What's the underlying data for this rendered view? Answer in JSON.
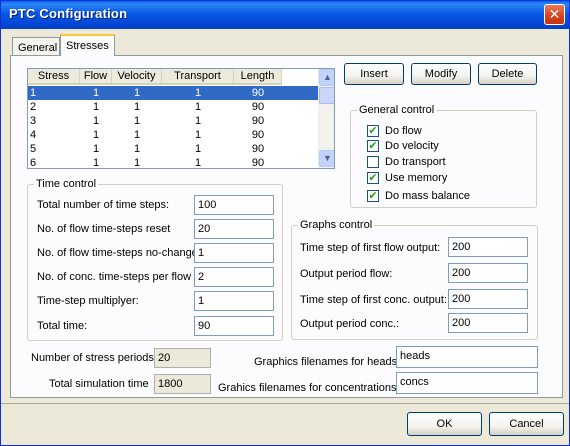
{
  "window": {
    "title": "PTC Configuration",
    "close_glyph": "✕"
  },
  "tabs": [
    {
      "label": "General"
    },
    {
      "label": "Stresses"
    }
  ],
  "stress_table": {
    "columns": [
      "Stress",
      "Flow",
      "Velocity",
      "Transport",
      "Length"
    ],
    "rows": [
      [
        "1",
        "1",
        "1",
        "1",
        "90"
      ],
      [
        "2",
        "1",
        "1",
        "1",
        "90"
      ],
      [
        "3",
        "1",
        "1",
        "1",
        "90"
      ],
      [
        "4",
        "1",
        "1",
        "1",
        "90"
      ],
      [
        "5",
        "1",
        "1",
        "1",
        "90"
      ],
      [
        "6",
        "1",
        "1",
        "1",
        "90"
      ]
    ],
    "selected_row": 0,
    "scroll_up_icon": "chevron-up-icon",
    "scroll_down_icon": "chevron-down-icon"
  },
  "actions": {
    "insert": "Insert",
    "modify": "Modify",
    "delete": "Delete"
  },
  "general_control": {
    "title": "General control",
    "items": [
      {
        "label": "Do flow",
        "checked": true
      },
      {
        "label": "Do velocity",
        "checked": true
      },
      {
        "label": "Do transport",
        "checked": false
      },
      {
        "label": "Use memory",
        "checked": true
      },
      {
        "label": "Do mass balance",
        "checked": true
      }
    ]
  },
  "time_control": {
    "title": "Time control",
    "fields": [
      {
        "label": "Total number of time steps:",
        "value": "100"
      },
      {
        "label": "No. of flow time-steps reset",
        "value": "20"
      },
      {
        "label": "No. of flow time-steps no-change",
        "value": "1"
      },
      {
        "label": "No. of conc. time-steps per flow",
        "value": "2"
      },
      {
        "label": "Time-step multiplyer:",
        "value": "1"
      },
      {
        "label": "Total time:",
        "value": "90"
      }
    ]
  },
  "graphs_control": {
    "title": "Graphs control",
    "fields": [
      {
        "label": "Time step of first flow output:",
        "value": "200"
      },
      {
        "label": "Output period flow:",
        "value": "200"
      },
      {
        "label": "Time step of first conc. output:",
        "value": "200"
      },
      {
        "label": "Output period conc.:",
        "value": "200"
      }
    ]
  },
  "summary": {
    "stress_periods_label": "Number of stress periods",
    "stress_periods_value": "20",
    "total_sim_time_label": "Total simulation time",
    "total_sim_time_value": "1800"
  },
  "filenames": {
    "heads_label": "Graphics filenames for heads:",
    "heads_value": "heads",
    "conc_label": "Grahics filenames for concentrations:",
    "conc_value": "concs"
  },
  "dialog_buttons": {
    "ok": "OK",
    "cancel": "Cancel"
  }
}
